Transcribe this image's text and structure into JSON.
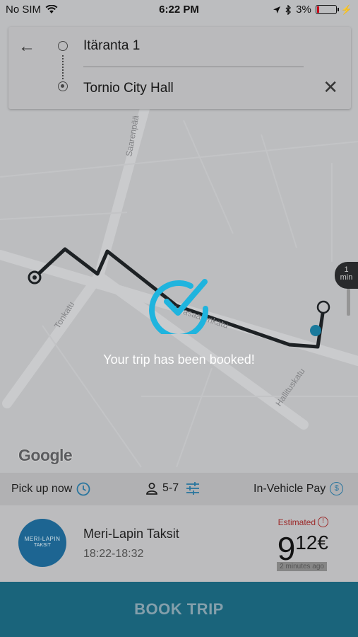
{
  "status_bar": {
    "carrier": "No SIM",
    "time": "6:22 PM",
    "battery": "3%"
  },
  "search": {
    "origin": "Itäranta 1",
    "destination": "Tornio City Hall"
  },
  "map": {
    "streets": [
      "Saarenpää",
      "Tonkatu",
      "Hallituskatu",
      "Karasaarenkatu"
    ],
    "eta": {
      "value": "1",
      "unit": "min"
    },
    "attribution": "Google"
  },
  "confirmation": {
    "message": "Your trip has been booked!"
  },
  "options": {
    "pickup": "Pick up now",
    "passengers": "5-7",
    "payment": "In-Vehicle Pay"
  },
  "provider": {
    "name": "Meri-Lapin Taksit",
    "time_window": "18:22-18:32",
    "logo_text_1": "MERI-LAPIN",
    "logo_text_2": "TAKSIT",
    "estimated_label": "Estimated",
    "price_major": "9",
    "price_minor": "12€",
    "note": "2 minutes ago"
  },
  "actions": {
    "book_trip": "BOOK TRIP"
  },
  "colors": {
    "accent": "#2a7aa5",
    "book_button": "#1c6980",
    "confirm": "#1fb4de",
    "route": "#1f2326"
  }
}
